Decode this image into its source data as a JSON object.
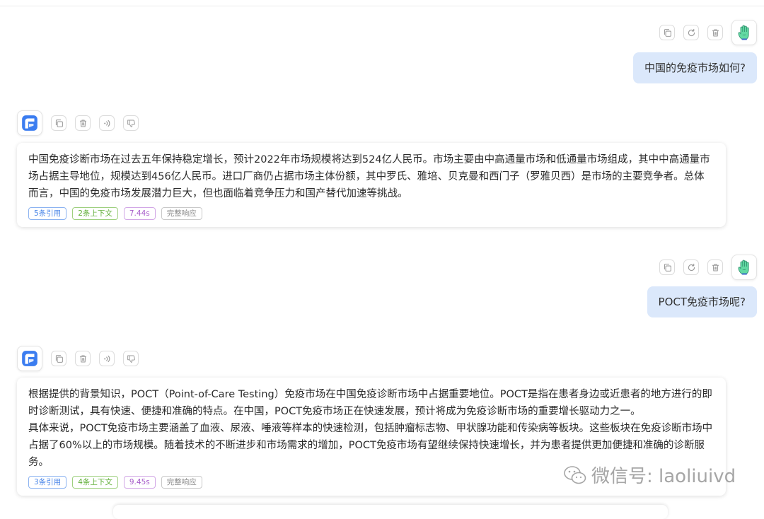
{
  "messages": [
    {
      "role": "user",
      "text": "中国的免疫市场如何?"
    },
    {
      "role": "assistant",
      "text": "中国免疫诊断市场在过去五年保持稳定增长，预计2022年市场规模将达到524亿人民币。市场主要由中高通量市场和低通量市场组成，其中中高通量市场占据主导地位，规模达到456亿人民币。进口厂商仍占据市场主体份额，其中罗氏、雅培、贝克曼和西门子（罗雅贝西）是市场的主要竞争者。总体而言，中国的免疫市场发展潜力巨大，但也面临着竞争压力和国产替代加速等挑战。",
      "tags": {
        "citations": "5条引用",
        "context": "2条上下文",
        "time": "7.44s",
        "status": "完整响应"
      }
    },
    {
      "role": "user",
      "text": "POCT免疫市场呢?"
    },
    {
      "role": "assistant",
      "text": "根据提供的背景知识，POCT（Point-of-Care Testing）免疫市场在中国免疫诊断市场中占据重要地位。POCT是指在患者身边或近患者的地方进行的即时诊断测试，具有快速、便捷和准确的特点。在中国，POCT免疫市场正在快速发展，预计将成为免疫诊断市场的重要增长驱动力之一。\n具体来说，POCT免疫市场主要涵盖了血液、尿液、唾液等样本的快速检测，包括肿瘤标志物、甲状腺功能和传染病等板块。这些板块在免疫诊断市场中占据了60%以上的市场规模。随着技术的不断进步和市场需求的增加，POCT免疫市场有望继续保持快速增长，并为患者提供更加便捷和准确的诊断服务。",
      "tags": {
        "citations": "3条引用",
        "context": "4条上下文",
        "time": "9.45s",
        "status": "完整响应"
      }
    }
  ],
  "watermark": "微信号: laoliuivd",
  "icons": {
    "user_actions": [
      "copy-icon",
      "refresh-icon",
      "delete-icon"
    ],
    "bot_actions": [
      "copy-icon",
      "delete-icon",
      "speaker-icon",
      "thumbs-down-icon"
    ],
    "user_avatar": "hand-avatar",
    "bot_avatar": "app-logo"
  },
  "colors": {
    "user_bubble": "#dbe8fb",
    "tag_blue": "#4a86e8",
    "tag_green": "#5fae36",
    "tag_purple": "#a65bc9",
    "tag_gray": "#888888",
    "logo_blue": "#3b7df0"
  }
}
